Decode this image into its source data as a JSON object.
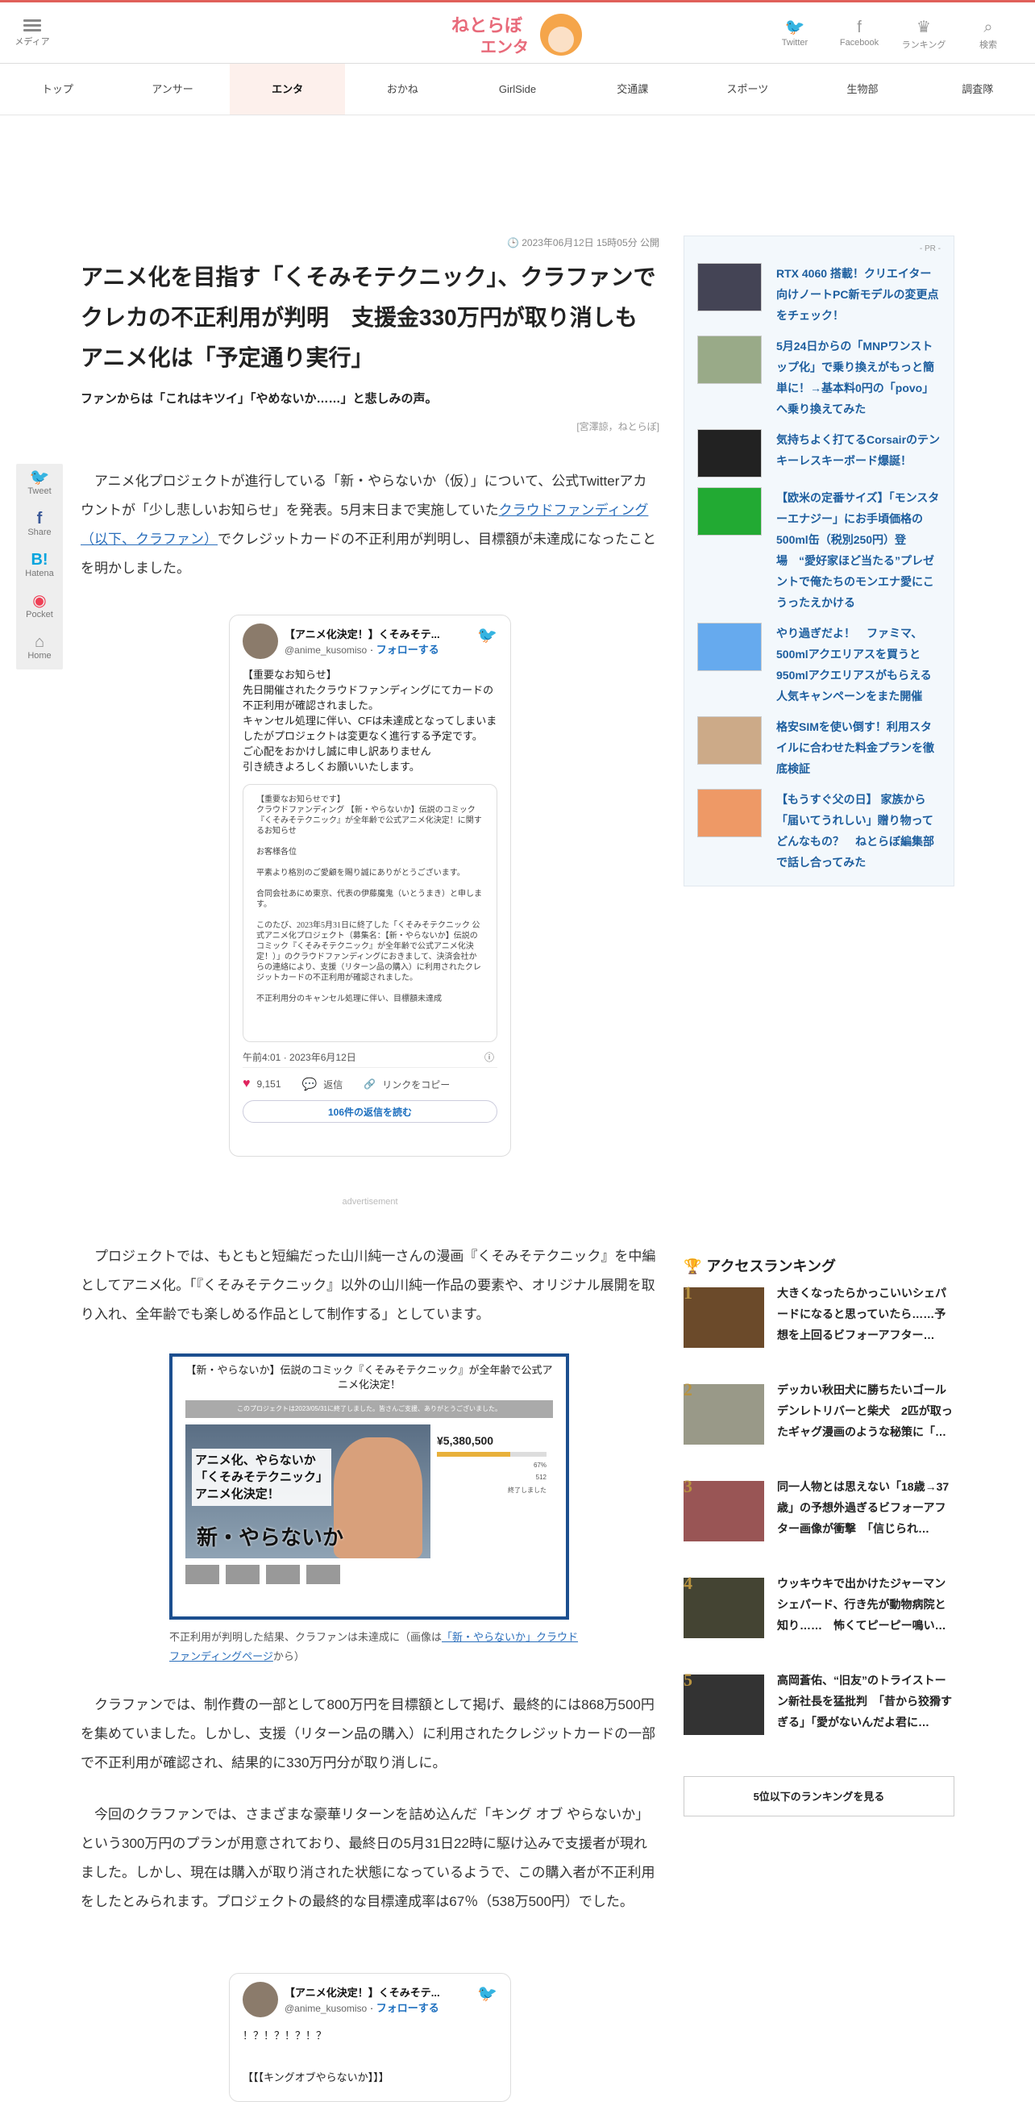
{
  "header": {
    "menu_label": "メディア",
    "logo_text": "ねとらぼ",
    "logo_sub": "エンタ",
    "icons": [
      {
        "name": "twitter-icon",
        "glyph": "🐦",
        "label": "Twitter"
      },
      {
        "name": "facebook-icon",
        "glyph": "f",
        "label": "Facebook"
      },
      {
        "name": "crown-icon",
        "glyph": "♛",
        "label": "ランキング"
      },
      {
        "name": "search-icon",
        "glyph": "⌕",
        "label": "検索"
      }
    ]
  },
  "nav": {
    "tabs": [
      "トップ",
      "アンサー",
      "エンタ",
      "おかね",
      "GirlSide",
      "交通課",
      "スポーツ",
      "生物部",
      "調査隊"
    ],
    "active": "エンタ"
  },
  "article": {
    "date": "2023年06月12日 15時05分 公開",
    "title": "アニメ化を目指す「くそみそテクニック」、クラファンでクレカの不正利用が判明　支援金330万円が取り消しもアニメ化は「予定通り実行」",
    "subtitle": "ファンからは「これはキツイ」「やめないか……」と悲しみの声。",
    "credit": "[宮澤諒，ねとらぼ]",
    "p1_before": "アニメ化プロジェクトが進行している「新・やらないか（仮）」について、公式Twitterアカウントが「少し悲しいお知らせ」を発表。5月末日まで実施していた",
    "p1_link": "クラウドファンディング（以下、クラファン）",
    "p1_after": "でクレジットカードの不正利用が判明し、目標額が未達成になったことを明かしました。",
    "advert": "advertisement",
    "p2": "プロジェクトでは、もともと短編だった山川純一さんの漫画『くそみそテクニック』を中編としてアニメ化。「『くそみそテクニック』以外の山川純一作品の要素や、オリジナル展開を取り入れ、全年齢でも楽しめる作品として制作する」としています。",
    "caption_before": "不正利用が判明した結果、クラファンは未達成に（画像は",
    "caption_link": "「新・やらないか」クラウドファンディングページ",
    "caption_after": "から）",
    "p3": "クラファンでは、制作費の一部として800万円を目標額として掲げ、最終的には868万500円を集めていました。しかし、支援（リターン品の購入）に利用されたクレジットカードの一部で不正利用が確認され、結果的に330万円分が取り消しに。",
    "p4": "今回のクラファンでは、さまざまな豪華リターンを詰め込んだ「キング オブ やらないか」という300万円のプランが用意されており、最終日の5月31日22時に駆け込みで支援者が現れました。しかし、現在は購入が取り消された状態になっているようで、この購入者が不正利用をしたとみられます。プロジェクトの最終的な目標達成率は67％（538万500円）でした。"
  },
  "share": [
    {
      "name": "tweet-share",
      "glyph": "🐦",
      "label": "Tweet",
      "color": "#1d9bf0"
    },
    {
      "name": "facebook-share",
      "glyph": "f",
      "label": "Share",
      "color": "#3b5998"
    },
    {
      "name": "hatena-share",
      "glyph": "B!",
      "label": "Hatena",
      "color": "#00a4de"
    },
    {
      "name": "pocket-share",
      "glyph": "◉",
      "label": "Pocket",
      "color": "#ef4056"
    },
    {
      "name": "home-share",
      "glyph": "⌂",
      "label": "Home",
      "color": "#888"
    }
  ],
  "tweet1": {
    "name": "【アニメ化決定！】くそみそテ...",
    "handle": "@anime_kusomiso",
    "follow": "フォローする",
    "text": "【重要なお知らせ】\n先日開催されたクラウドファンディングにてカードの不正利用が確認されました。\nキャンセル処理に伴い、CFは未達成となってしまいましたがプロジェクトは変更なく進行する予定です。\nご心配をおかけし誠に申し訳ありません\n引き続きよろしくお願いいたします。",
    "image_text": "【重要なお知らせです】\nクラウドファンディング 【新・やらないか】伝説のコミック『くそみそテクニック』が全年齢で公式アニメ化決定！に関するお知らせ\n\nお客様各位\n\n平素より格別のご愛顧を賜り誠にありがとうございます。\n\n合同会社あにめ東京、代表の伊藤魔鬼（いとうまき）と申します。\n\nこのたび、2023年5月31日に終了した「くそみそテクニック 公式アニメ化プロジェクト（募集名：【新・やらないか】伝説のコミック『くそみそテクニック』が全年齢で公式アニメ化決定！）」のクラウドファンディングにおきまして、決済会社からの連絡により、支援（リターン品の購入）に利用されたクレジットカードの不正利用が確認されました。\n\n不正利用分のキャンセル処理に伴い、目標額未達成",
    "time": "午前4:01 · 2023年6月12日",
    "likes": "9,151",
    "reply": "返信",
    "copy": "リンクをコピー",
    "more": "106件の返信を読む"
  },
  "figure": {
    "title": "【新・やらないか】伝説のコミック『くそみそテクニック』が全年齢で公式アニメ化決定！",
    "banner": "このプロジェクトは2023/05/31に終了しました。皆さんご支援、ありがとうございました。",
    "art_text": "アニメ化、やらないか\n「くそみそテクニック」\nアニメ化決定！",
    "art_big": "新・やらないか",
    "amount": "¥5,380,500",
    "rate": "67%",
    "backers": "512",
    "status": "終了しました",
    "progress": 0.67
  },
  "tweet2": {
    "name": "【アニメ化決定！】くそみそテ...",
    "handle": "@anime_kusomiso",
    "follow": "フォローする",
    "text": "！？！？！？！？\n\n【【【キングオブやらないか】】】"
  },
  "sidebar": {
    "pr": "- PR -",
    "ads": [
      {
        "text": "RTX 4060 搭載！クリエイター向けノートPC新モデルの変更点をチェック！",
        "color": "#445"
      },
      {
        "text": "5月24日からの「MNPワンストップ化」で乗り換えがもっと簡単に！→基本料0円の「povo」へ乗り換えてみた",
        "color": "#9a8"
      },
      {
        "text": "気持ちよく打てるCorsairのテンキーレスキーボード爆誕！",
        "color": "#222"
      },
      {
        "text": "【欧米の定番サイズ】「モンスターエナジー」にお手頃価格の500ml缶（税別250円）登場　“愛好家ほど当たる”プレゼントで俺たちのモンエナ愛にこうったえかける",
        "color": "#2a3"
      },
      {
        "text": "やり過ぎだよ！　ファミマ、500mlアクエリアスを買うと950mlアクエリアスがもらえる人気キャンペーンをまた開催",
        "color": "#6ae"
      },
      {
        "text": "格安SIMを使い倒す！利用スタイルに合わせた料金プランを徹底検証",
        "color": "#ca8"
      },
      {
        "text": "【もうすぐ父の日】 家族から「届いてうれしい」贈り物ってどんなもの？　ねとらぼ編集部で話し合ってみた",
        "color": "#e96"
      }
    ]
  },
  "ranking": {
    "title": "アクセスランキング",
    "items": [
      {
        "num": "1",
        "text": "大きくなったらかっこいいシェパードになると思っていたら……予想を上回るビフォーアフター…",
        "color": "#6b4a2a"
      },
      {
        "num": "2",
        "text": "デッカい秋田犬に勝ちたいゴールデンレトリバーと柴犬　2匹が取ったギャグ漫画のような秘策に「…",
        "color": "#998"
      },
      {
        "num": "3",
        "text": "同一人物とは思えない「18歳→37歳」の予想外過ぎるビフォーアフター画像が衝撃　「信じられ…",
        "color": "#955"
      },
      {
        "num": "4",
        "text": "ウッキウキで出かけたジャーマンシェパード、行き先が動物病院と知り……　怖くてピーピー鳴い…",
        "color": "#443"
      },
      {
        "num": "5",
        "text": "高岡蒼佑、“旧友”のトライストーン新社長を猛批判　「昔から狡猾すぎる」「愛がないんだよ君に…",
        "color": "#333"
      }
    ],
    "more": "5位以下のランキングを見る"
  }
}
